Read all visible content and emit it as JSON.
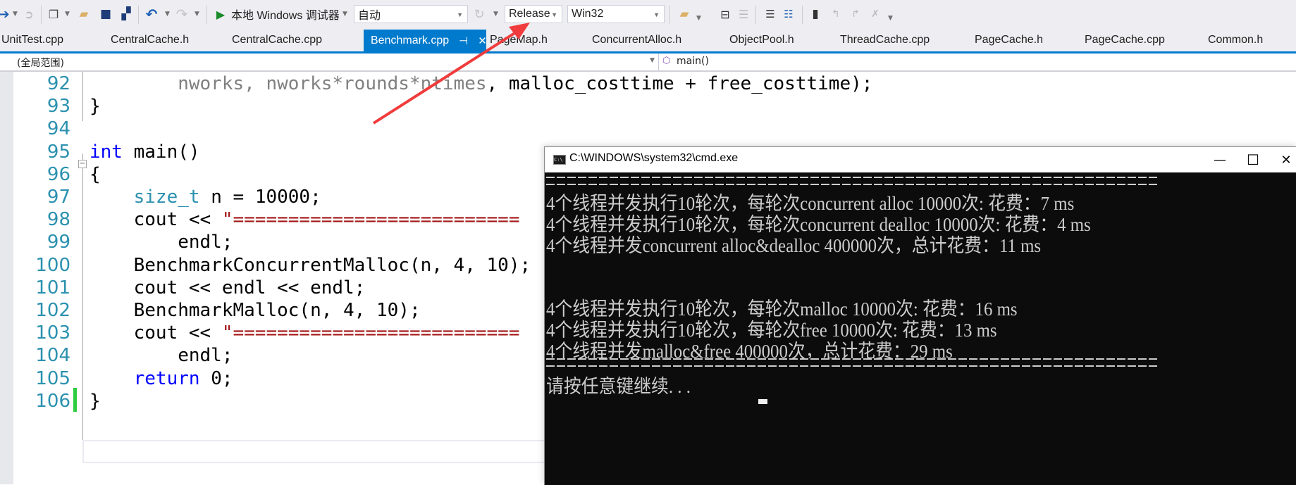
{
  "toolbar": {
    "run_label": "本地 Windows 调试器",
    "solution_config": "自动",
    "build_config": "Release",
    "platform": "Win32",
    "icons": [
      "back-icon",
      "forward-icon",
      "new-project-icon",
      "open-file-icon",
      "save-icon",
      "save-all-icon",
      "undo-icon",
      "redo-icon",
      "start-debug-icon",
      "refresh-icon",
      "find-in-files-icon",
      "toggle-comment-icon",
      "uncomment-icon",
      "indent-icon",
      "outdent-icon",
      "bookmark-icon",
      "prev-bookmark-icon",
      "next-bookmark-icon",
      "clear-bookmarks-icon"
    ]
  },
  "tabs": [
    {
      "label": "UnitTest.cpp",
      "active": false
    },
    {
      "label": "CentralCache.h",
      "active": false
    },
    {
      "label": "CentralCache.cpp",
      "active": false
    },
    {
      "label": "Benchmark.cpp",
      "active": true
    },
    {
      "label": "PageMap.h",
      "active": false
    },
    {
      "label": "ConcurrentAlloc.h",
      "active": false
    },
    {
      "label": "ObjectPool.h",
      "active": false
    },
    {
      "label": "ThreadCache.cpp",
      "active": false
    },
    {
      "label": "PageCache.h",
      "active": false
    },
    {
      "label": "PageCache.cpp",
      "active": false
    },
    {
      "label": "Common.h",
      "active": false
    }
  ],
  "tab_pin_glyph": "⊣",
  "tab_close_glyph": "✕",
  "navbar": {
    "scope": "(全局范围)",
    "function": "main()"
  },
  "editor": {
    "lines": [
      {
        "num": "92",
        "parts": [
          [
            "dim",
            "        nworks, nworks*rounds*ntimes"
          ],
          [
            "",
            "，"
          ]
        ]
      },
      {
        "num": "93",
        "parts": [
          [
            "",
            "}"
          ]
        ]
      },
      {
        "num": "94",
        "parts": []
      },
      {
        "num": "95",
        "parts": [
          [
            "kw",
            "int"
          ],
          [
            "",
            " main()"
          ]
        ]
      },
      {
        "num": "96",
        "parts": [
          [
            "",
            "{"
          ]
        ]
      },
      {
        "num": "97",
        "parts": [
          [
            "",
            "    "
          ],
          [
            "ty",
            "size_t"
          ],
          [
            "",
            " n = 10000;"
          ]
        ]
      },
      {
        "num": "98",
        "parts": [
          [
            "",
            "    cout << "
          ],
          [
            "str",
            "\"=========================="
          ]
        ]
      },
      {
        "num": "99",
        "parts": [
          [
            "",
            "        endl;"
          ]
        ]
      },
      {
        "num": "100",
        "parts": [
          [
            "",
            "    BenchmarkConcurrentMalloc(n, 4, 10);"
          ]
        ]
      },
      {
        "num": "101",
        "parts": [
          [
            "",
            "    cout << endl << endl;"
          ]
        ]
      },
      {
        "num": "102",
        "parts": [
          [
            "",
            "    BenchmarkMalloc(n, 4, 10);"
          ]
        ]
      },
      {
        "num": "103",
        "parts": [
          [
            "",
            "    cout << "
          ],
          [
            "str",
            "\"=========================="
          ]
        ]
      },
      {
        "num": "104",
        "parts": [
          [
            "",
            "        endl;"
          ]
        ]
      },
      {
        "num": "105",
        "parts": [
          [
            "",
            "    "
          ],
          [
            "kw",
            "return"
          ],
          [
            "",
            " 0;"
          ]
        ]
      },
      {
        "num": "106",
        "parts": [
          [
            "",
            "}"
          ]
        ]
      }
    ],
    "line92_tail": ", malloc_costtime + free_costtime);"
  },
  "console": {
    "title": "C:\\WINDOWS\\system32\\cmd.exe",
    "minimize_glyph": "—",
    "maximize_glyph": "☐",
    "close_glyph": "✕",
    "lines": [
      "4个线程并发执行10轮次，每轮次concurrent alloc 10000次: 花费：7 ms",
      "4个线程并发执行10轮次，每轮次concurrent dealloc 10000次: 花费：4 ms",
      "4个线程并发concurrent alloc&dealloc 400000次，总计花费：11 ms",
      "4个线程并发执行10轮次，每轮次malloc 10000次: 花费：16 ms",
      "4个线程并发执行10轮次，每轮次free 10000次: 花费：13 ms",
      "4个线程并发malloc&free 400000次，总计花费：29 ms",
      "请按任意键继续. . ."
    ]
  },
  "annotation": {
    "arrow_color": "#f03c3c"
  }
}
